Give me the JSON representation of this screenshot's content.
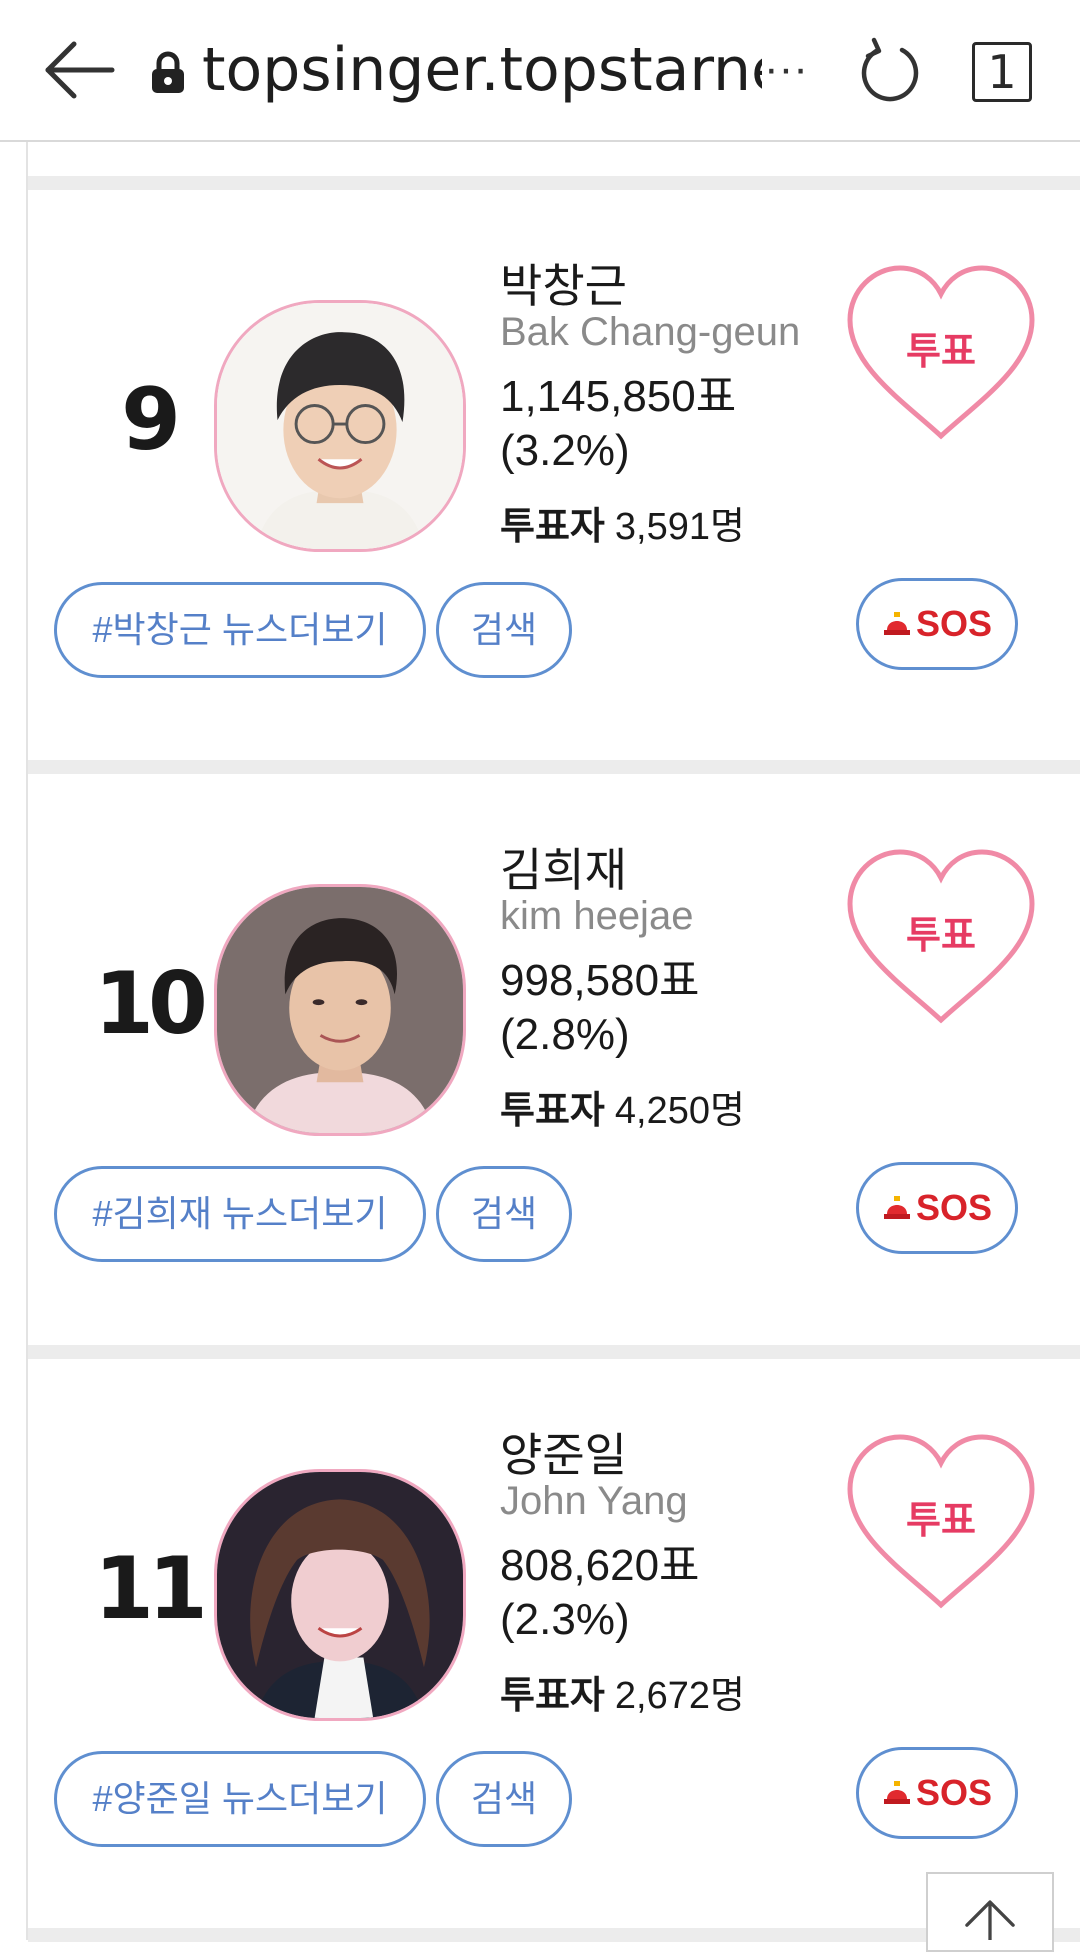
{
  "browser": {
    "url": "topsinger.topstarne",
    "more": "···",
    "tab_count": "1"
  },
  "colors": {
    "accent_blue": "#5f8fd0",
    "heart_pink": "#f08aa6",
    "vote_text": "#e63b63",
    "sos_red": "#d8232a"
  },
  "entries": [
    {
      "rank": "9",
      "name_ko": "박창근",
      "name_en": "Bak Chang-geun",
      "votes": "1,145,850표",
      "percent": "(3.2%)",
      "voters_label": "투표자",
      "voters_count": "3,591명",
      "vote_button": "투표",
      "news_button": "#박창근 뉴스더보기",
      "search_button": "검색",
      "sos_button": "SOS"
    },
    {
      "rank": "10",
      "name_ko": "김희재",
      "name_en": "kim heejae",
      "votes": "998,580표",
      "percent": "(2.8%)",
      "voters_label": "투표자",
      "voters_count": "4,250명",
      "vote_button": "투표",
      "news_button": "#김희재 뉴스더보기",
      "search_button": "검색",
      "sos_button": "SOS"
    },
    {
      "rank": "11",
      "name_ko": "양준일",
      "name_en": "John Yang",
      "votes": "808,620표",
      "percent": "(2.3%)",
      "voters_label": "투표자",
      "voters_count": "2,672명",
      "vote_button": "투표",
      "news_button": "#양준일 뉴스더보기",
      "search_button": "검색",
      "sos_button": "SOS"
    }
  ]
}
